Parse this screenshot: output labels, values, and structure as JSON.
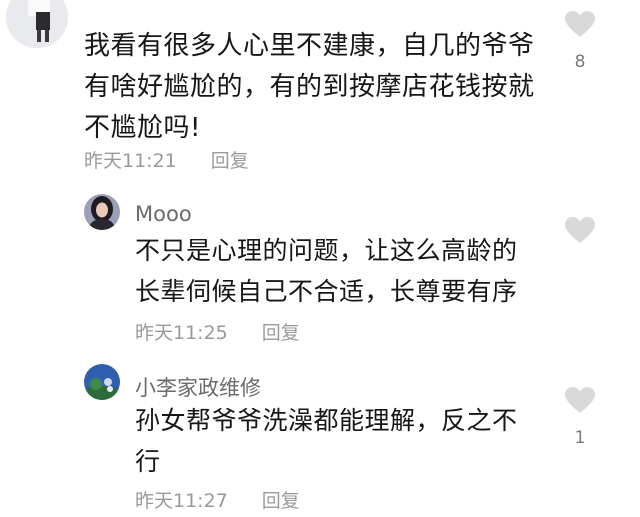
{
  "comments": [
    {
      "text_lines": [
        "我看有很多人心里不建康，自几的爷爷",
        "有啥好尴尬的，有的到按摩店花钱按就",
        "不尴尬吗!"
      ],
      "time": "昨天11:21",
      "reply_label": "回复",
      "like_count": "8"
    },
    {
      "username": "Mooo",
      "text_lines": [
        "不只是心理的问题，让这么高龄的",
        "长辈伺候自己不合适，长尊要有序"
      ],
      "time": "昨天11:25",
      "reply_label": "回复",
      "like_count": ""
    },
    {
      "username": "小李家政维修",
      "text_lines": [
        "孙女帮爷爷洗澡都能理解，反之不",
        "行"
      ],
      "time": "昨天11:27",
      "reply_label": "回复",
      "like_count": "1"
    }
  ],
  "colors": {
    "heart": "#d9d9d9",
    "meta_text": "#9a9a9a",
    "username": "#6b6b6b"
  }
}
